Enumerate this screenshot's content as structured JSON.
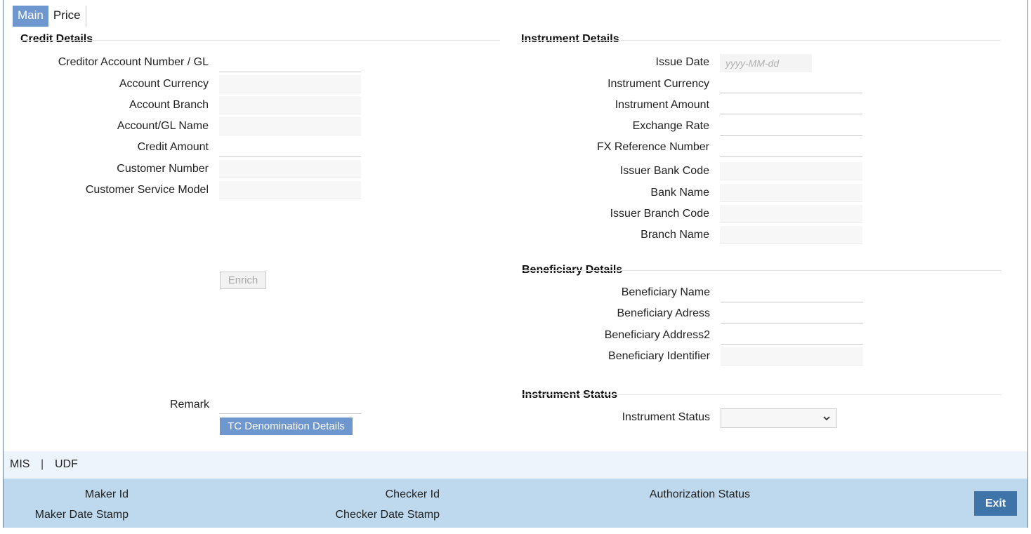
{
  "tabs": [
    {
      "label": "Main",
      "active": true
    },
    {
      "label": "Price",
      "active": false
    }
  ],
  "credit_details": {
    "title": "Credit Details",
    "fields": [
      {
        "label": "Creditor Account Number / GL",
        "value": ""
      },
      {
        "label": "Account Currency",
        "value": ""
      },
      {
        "label": "Account Branch",
        "value": ""
      },
      {
        "label": "Account/GL Name",
        "value": ""
      },
      {
        "label": "Credit Amount",
        "value": ""
      },
      {
        "label": "Customer Number",
        "value": ""
      },
      {
        "label": "Customer Service Model",
        "value": ""
      }
    ],
    "enrich_label": "Enrich",
    "remark_label": "Remark",
    "tc_button_label": "TC Denomination Details"
  },
  "instrument_details": {
    "title": "Instrument Details",
    "issue_date_label": "Issue Date",
    "issue_date_placeholder": "yyyy-MM-dd",
    "fields": [
      {
        "label": "Instrument Currency",
        "value": ""
      },
      {
        "label": "Instrument Amount",
        "value": ""
      },
      {
        "label": "Exchange Rate",
        "value": ""
      },
      {
        "label": "FX Reference Number",
        "value": ""
      },
      {
        "label": "Issuer Bank Code",
        "value": ""
      },
      {
        "label": "Bank Name",
        "value": ""
      },
      {
        "label": "Issuer Branch Code",
        "value": ""
      },
      {
        "label": "Branch Name",
        "value": ""
      }
    ]
  },
  "beneficiary_details": {
    "title": "Beneficiary Details",
    "fields": [
      {
        "label": "Beneficiary Name",
        "value": ""
      },
      {
        "label": "Beneficiary Adress",
        "value": ""
      },
      {
        "label": "Beneficiary Address2",
        "value": ""
      },
      {
        "label": "Beneficiary Identifier",
        "value": ""
      }
    ]
  },
  "instrument_status": {
    "title": "Instrument Status",
    "label": "Instrument Status",
    "selected": ""
  },
  "footer_links": {
    "mis": "MIS",
    "separator": "|",
    "udf": "UDF"
  },
  "audit": {
    "maker_id": "Maker Id",
    "maker_date_stamp": "Maker Date Stamp",
    "checker_id": "Checker Id",
    "checker_date_stamp": "Checker Date Stamp",
    "authorization_status": "Authorization Status",
    "exit_label": "Exit"
  },
  "colors": {
    "accent": "#6f97cf",
    "audit_bar": "#bed9ee",
    "exit_button": "#3f74a9"
  }
}
